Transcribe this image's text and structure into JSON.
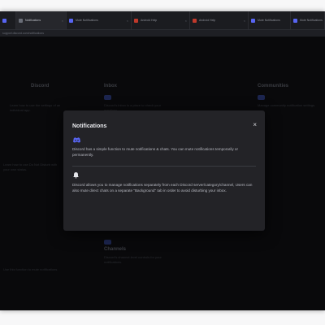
{
  "browser": {
    "tabs": [
      {
        "label": "Discord",
        "color": "#5865f2",
        "active": false
      },
      {
        "label": "Notifications",
        "color": "#6a6e78",
        "active": true
      },
      {
        "label": "Mute Notifications",
        "color": "#5865f2",
        "active": false
      },
      {
        "label": "Android Help",
        "color": "#c0392b",
        "active": false
      },
      {
        "label": "Android Help",
        "color": "#c0392b",
        "active": false
      },
      {
        "label": "Mute Notifications",
        "color": "#5865f2",
        "active": false
      },
      {
        "label": "Mute Notifications",
        "color": "#5865f2",
        "active": false
      }
    ],
    "url": "support.discord.com/notifications"
  },
  "background": {
    "columns": [
      {
        "title": "Discord",
        "text": "Learn how to use the settings of an individual app."
      },
      {
        "title": "Inbox",
        "text": "Discord's inbox is a place to check your mentions."
      },
      {
        "title": "Communities",
        "text": "Manage community notification settings."
      }
    ],
    "lower_left": "Learn how to use Do Not Disturb with your own status.",
    "lower_mid_title": "Channels",
    "lower_mid_text": "Discord's channel-level controls for your notifications.",
    "bottom_left": "Use this function to mute notifications."
  },
  "modal": {
    "title": "Notifications",
    "close_label": "×",
    "text1": "Discord has a simple function to mute notifications & chats. You can mute notifications temporarily or permanently.",
    "text2": "Discord allows you to manage notifications separately from each Discord server/category/channel, Users can also mute direct chats on a separate \"Background\" tab in order to avoid disturbing your inbox."
  },
  "colors": {
    "accent": "#5865f2",
    "modal_bg": "#232327",
    "page_bg": "#0f0f12"
  }
}
